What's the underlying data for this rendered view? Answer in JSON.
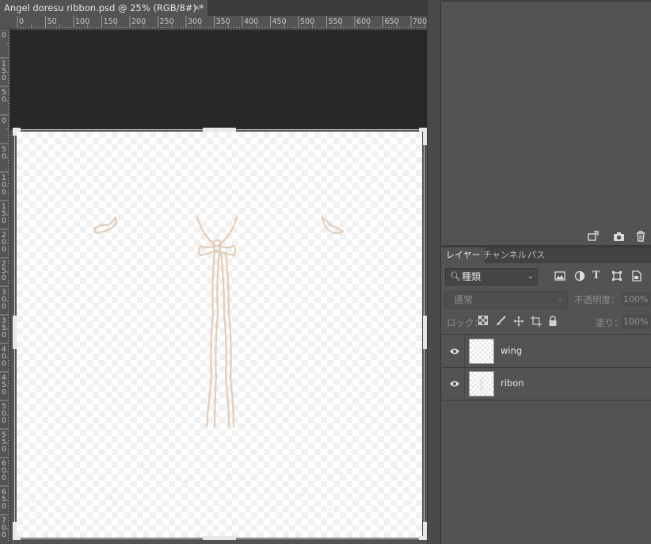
{
  "document": {
    "tab_title": "Angel doresu ribbon.psd @ 25% (RGB/8#) *",
    "close_glyph": "×"
  },
  "rulers": {
    "horizontal": [
      "0",
      "50",
      "100",
      "150",
      "200",
      "250",
      "300",
      "350",
      "400",
      "450",
      "500",
      "550",
      "600",
      "650",
      "700"
    ],
    "vertical": [
      "0",
      "150",
      "50",
      "0",
      "50",
      "100",
      "150",
      "200",
      "250",
      "300",
      "350",
      "400",
      "450",
      "500",
      "550",
      "600",
      "650",
      "700"
    ]
  },
  "layers_panel": {
    "tabs": [
      {
        "label": "レイヤー",
        "active": true
      },
      {
        "label": "チャンネル",
        "active": false
      },
      {
        "label": "パス",
        "active": false
      }
    ],
    "filter": {
      "kind_label": "種類"
    },
    "filter_icons": [
      "image-filter-icon",
      "adjustment-filter-icon",
      "type-filter-icon",
      "shape-filter-icon",
      "smart-object-filter-icon"
    ],
    "blend_mode": "通常",
    "opacity_label": "不透明度：",
    "opacity_value": "100%",
    "lock_label": "ロック：",
    "fill_label": "塗り：",
    "fill_value": "100%",
    "layers": [
      {
        "name": "wing",
        "visible": true
      },
      {
        "name": "ribon",
        "visible": true
      }
    ]
  },
  "upper_panel_icons": [
    "new-layer-from-icon",
    "camera-icon",
    "trash-icon"
  ],
  "colors": {
    "panel_bg": "#535353",
    "pasteboard": "#282828",
    "ribbon_stroke": "#e3cbb6"
  }
}
